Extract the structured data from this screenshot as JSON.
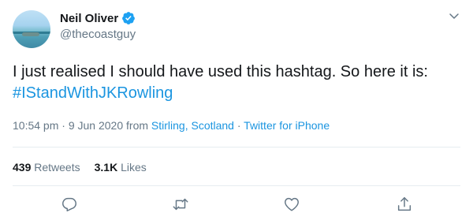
{
  "author": {
    "name": "Neil Oliver",
    "handle": "@thecoastguy"
  },
  "tweet": {
    "text": "I just realised I should have used this hashtag. So here it is: ",
    "hashtag": "#IStandWithJKRowling"
  },
  "meta": {
    "time": "10:54 pm",
    "separator1": " · ",
    "date": "9 Jun 2020",
    "from_word": " from ",
    "location": "Stirling, Scotland",
    "separator2": " · ",
    "source": "Twitter for iPhone"
  },
  "stats": {
    "retweets_count": "439",
    "retweets_label": "Retweets",
    "likes_count": "3.1K",
    "likes_label": "Likes"
  },
  "icons": {
    "verified": "verified-badge-icon",
    "chevron": "chevron-down-icon",
    "reply": "reply-icon",
    "retweet": "retweet-icon",
    "like": "heart-icon",
    "share": "share-icon"
  },
  "colors": {
    "link": "#1b95e0",
    "secondary_text": "#657786",
    "primary_text": "#14171a",
    "verified": "#1da1f2"
  }
}
